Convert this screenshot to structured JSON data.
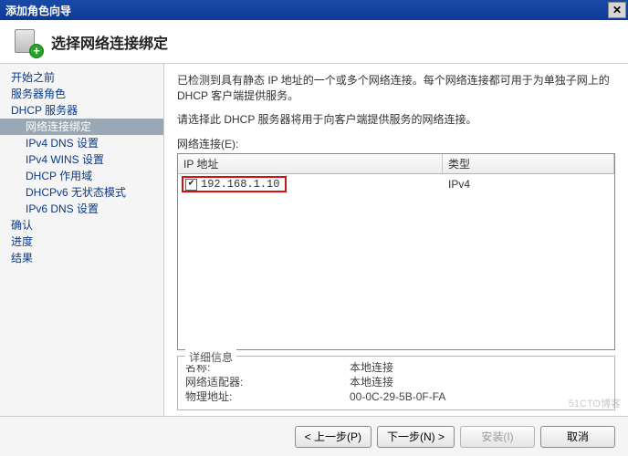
{
  "window": {
    "title": "添加角色向导"
  },
  "header": {
    "page_title": "选择网络连接绑定"
  },
  "sidebar": {
    "items": [
      {
        "label": "开始之前",
        "sub": false
      },
      {
        "label": "服务器角色",
        "sub": false
      },
      {
        "label": "DHCP 服务器",
        "sub": false
      },
      {
        "label": "网络连接绑定",
        "sub": true,
        "selected": true
      },
      {
        "label": "IPv4 DNS 设置",
        "sub": true
      },
      {
        "label": "IPv4 WINS 设置",
        "sub": true
      },
      {
        "label": "DHCP 作用域",
        "sub": true
      },
      {
        "label": "DHCPv6 无状态模式",
        "sub": true
      },
      {
        "label": "IPv6 DNS 设置",
        "sub": true
      },
      {
        "label": "确认",
        "sub": false
      },
      {
        "label": "进度",
        "sub": false
      },
      {
        "label": "结果",
        "sub": false
      }
    ]
  },
  "main": {
    "intro": "已检测到具有静态 IP 地址的一个或多个网络连接。每个网络连接都可用于为单独子网上的 DHCP 客户端提供服务。",
    "instruction": "请选择此 DHCP 服务器将用于向客户端提供服务的网络连接。",
    "list_label": "网络连接(E):",
    "columns": {
      "ip": "IP 地址",
      "type": "类型"
    },
    "rows": [
      {
        "checked": true,
        "ip": "192.168.1.10",
        "type": "IPv4"
      }
    ],
    "details": {
      "legend": "详细信息",
      "name_label": "名称:",
      "name_value": "本地连接",
      "adapter_label": "网络适配器:",
      "adapter_value": "本地连接",
      "mac_label": "物理地址:",
      "mac_value": "00-0C-29-5B-0F-FA"
    }
  },
  "footer": {
    "prev": "< 上一步(P)",
    "next": "下一步(N) >",
    "install": "安装(I)",
    "cancel": "取消"
  },
  "watermark": "51CTO博客"
}
